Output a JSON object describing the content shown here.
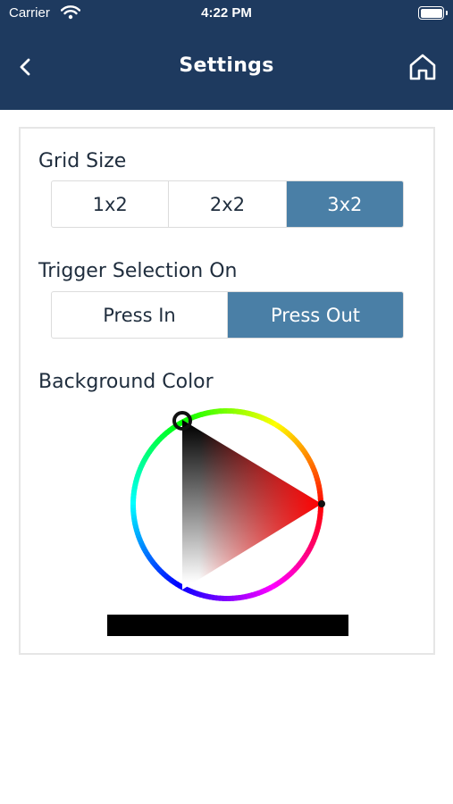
{
  "status_bar": {
    "carrier": "Carrier",
    "time": "4:22 PM"
  },
  "nav": {
    "title": "Settings",
    "back_icon": "chevron-left-icon",
    "home_icon": "home-icon"
  },
  "grid_size": {
    "label": "Grid Size",
    "options": [
      "1x2",
      "2x2",
      "3x2"
    ],
    "selected": "3x2"
  },
  "trigger": {
    "label": "Trigger Selection On",
    "options": [
      "Press In",
      "Press Out"
    ],
    "selected": "Press Out"
  },
  "background_color": {
    "label": "Background Color",
    "hue": "#ff0000",
    "value": "#000000"
  },
  "colors": {
    "nav_bg": "#1e3a5f",
    "accent": "#4a7fa6",
    "text": "#1f2d3d"
  }
}
